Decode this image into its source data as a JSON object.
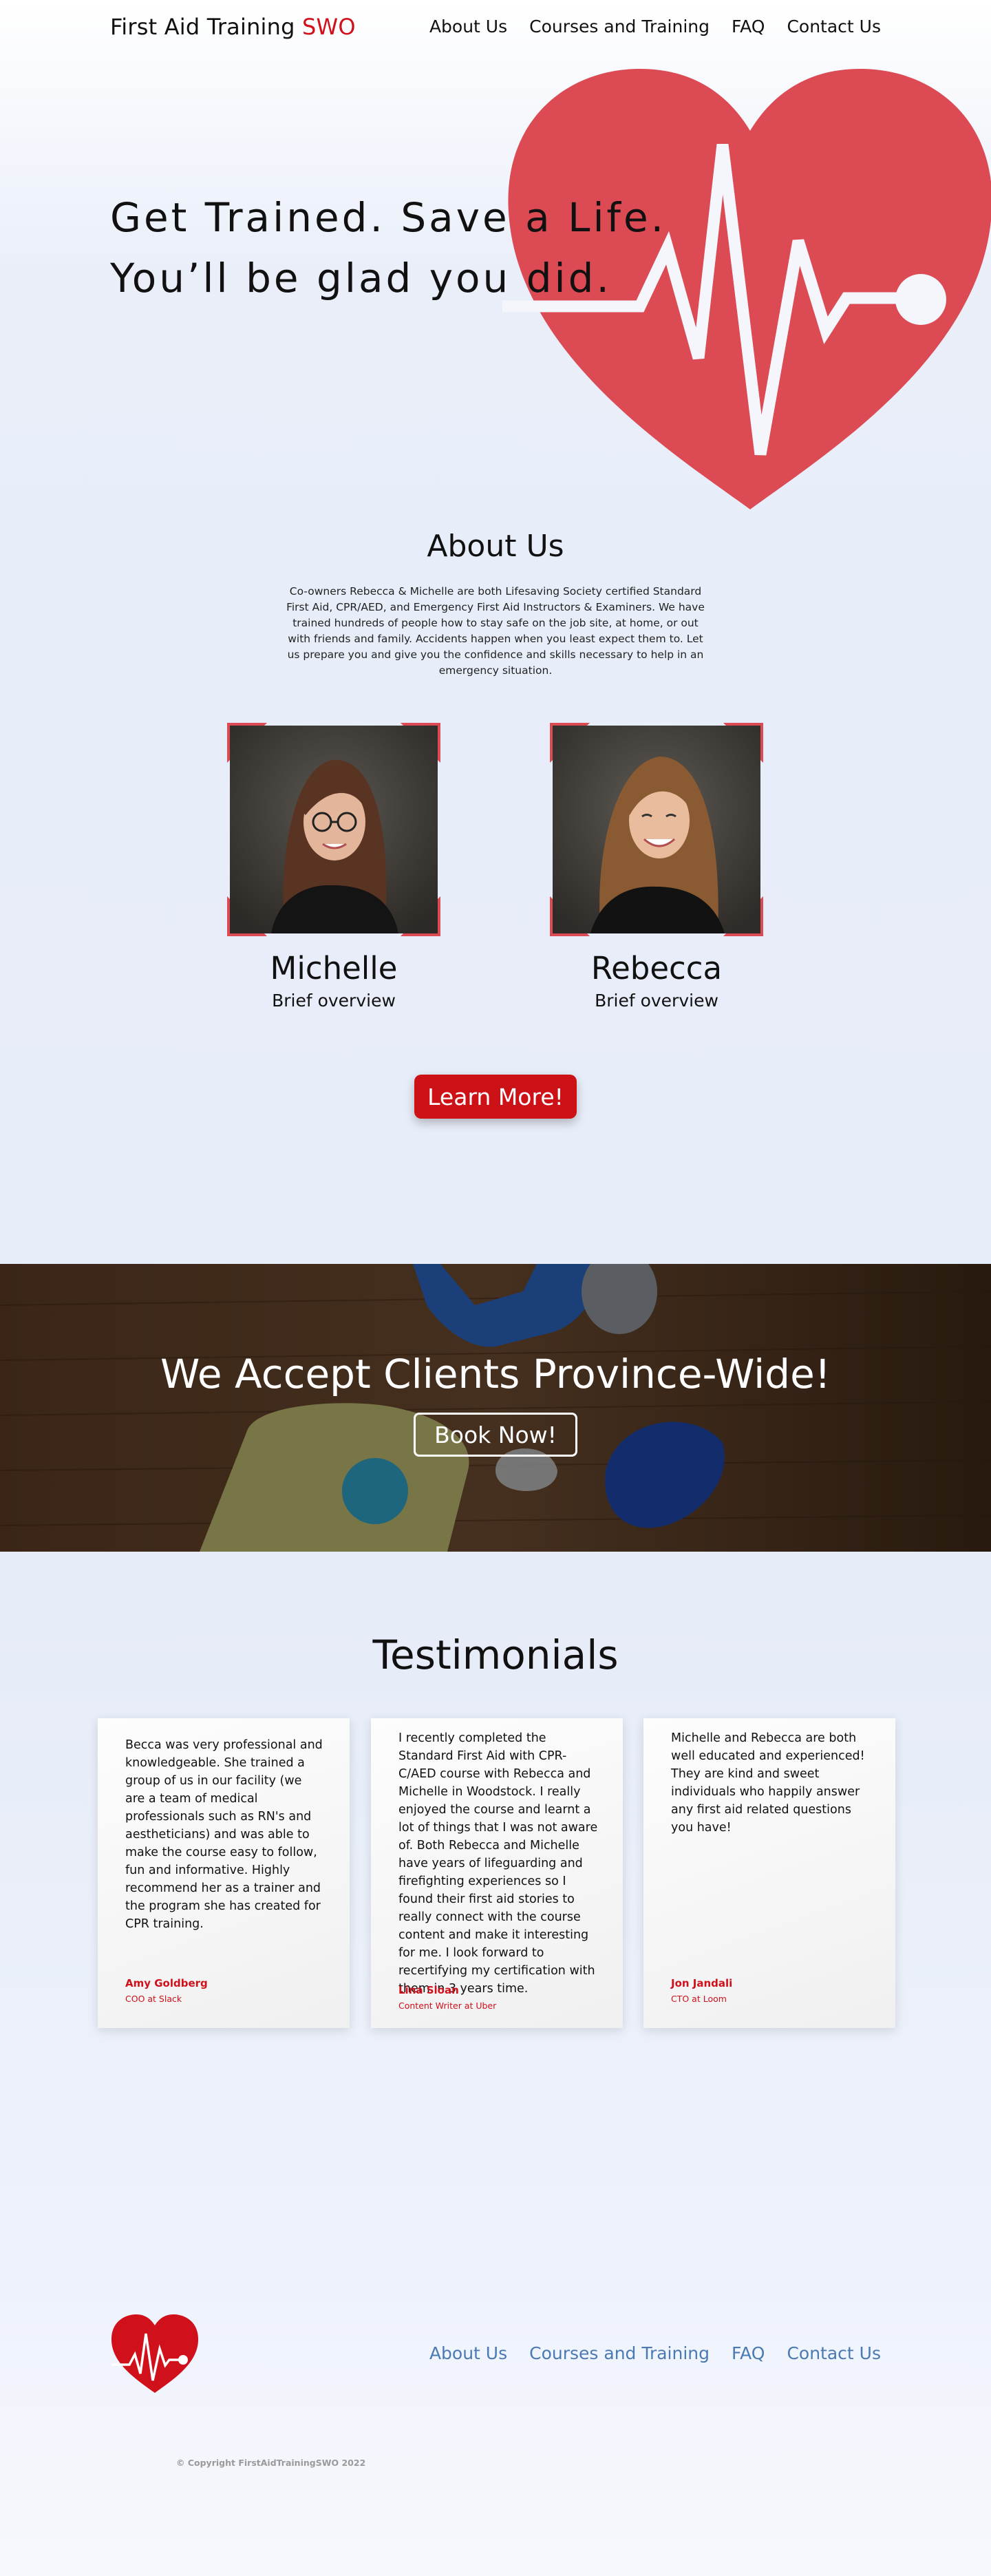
{
  "header": {
    "logo_main": "First Aid Training ",
    "logo_accent": "SWO",
    "nav": [
      "About Us",
      "Courses and Training",
      "FAQ",
      "Contact Us"
    ]
  },
  "hero": {
    "line1": "Get Trained. Save a Life.",
    "line2": "You’ll be glad you did.",
    "heart_icon": "heartbeat-heart-icon"
  },
  "about": {
    "title": "About Us",
    "text": "Co-owners Rebecca & Michelle are both Lifesaving Society certified Standard First Aid, CPR/AED, and Emergency First Aid Instructors & Examiners. We have trained hundreds of people how to stay safe on the job site, at home, or out with friends and family. Accidents happen when you least expect them to. Let us prepare you and give you the confidence and skills necessary to help in an emergency situation.",
    "people": [
      {
        "name": "Michelle",
        "subtitle": "Brief overview"
      },
      {
        "name": "Rebecca",
        "subtitle": "Brief overview"
      }
    ],
    "button": "Learn More!"
  },
  "banner": {
    "title": "We Accept Clients Province-Wide!",
    "button": "Book Now!"
  },
  "testimonials": {
    "title": "Testimonials",
    "items": [
      {
        "quote": "Becca was very professional and knowledgeable. She trained a group of us in our facility (we are a team of medical professionals such as RN's and aestheticians) and was able to make the course easy to follow, fun and informative. Highly recommend her as a trainer and the program she has created for CPR training.",
        "author": "Amy Goldberg",
        "role": "COO at Slack"
      },
      {
        "quote": "I recently completed the Standard First Aid with CPR-C/AED course with Rebecca and Michelle in Woodstock. I really enjoyed the course and learnt a lot of things that I was not aware of. Both Rebecca and Michelle have years of lifeguarding and firefighting experiences so I found their first aid stories to really connect with the course content and make it interesting for me. I look forward to recertifying my certification with them in 3 years time.",
        "author": "Lina Sloan",
        "role": "Content Writer at Uber"
      },
      {
        "quote": "Michelle and Rebecca are both well educated and experienced! They are kind and sweet individuals who happily answer any first aid related questions you have!",
        "author": "Jon Jandali",
        "role": "CTO at Loom"
      }
    ]
  },
  "footer": {
    "nav": [
      "About Us",
      "Courses and Training",
      "FAQ",
      "Contact Us"
    ],
    "copyright": "© Copyright FirstAidTrainingSWO 2022"
  },
  "colors": {
    "accent_red": "#d0101a",
    "heart_red": "#dc4a54",
    "footer_link": "#4b7ab3",
    "background": "#e9eef9"
  }
}
